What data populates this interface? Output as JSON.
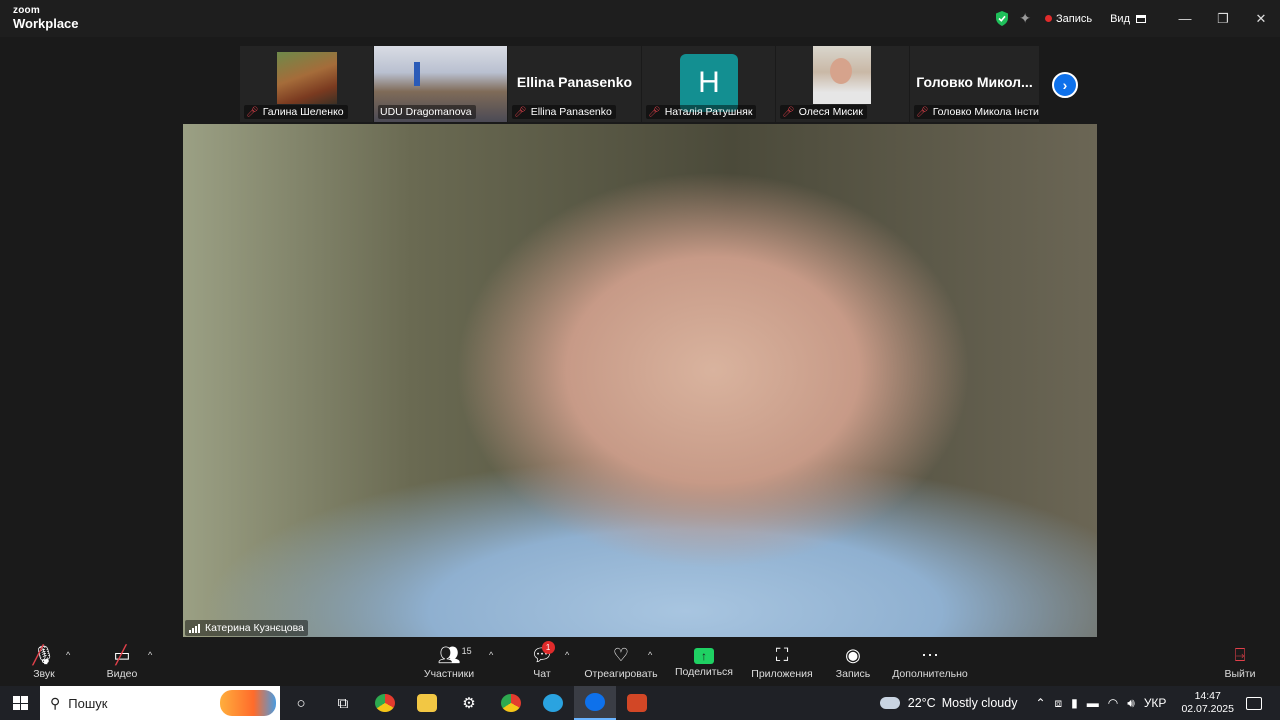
{
  "app": {
    "logo_top": "zoom",
    "logo_bottom": "Workplace"
  },
  "titlebar": {
    "record_label": "Запись",
    "view_label": "Вид",
    "minimize": "—",
    "maximize": "❐",
    "close": "✕"
  },
  "strip": {
    "tiles": [
      {
        "name": "Галина Шеленко",
        "big": ""
      },
      {
        "name": "UDU Dragomanova",
        "big": ""
      },
      {
        "name": "Ellina Panasenko",
        "big": "Ellina Panasenko"
      },
      {
        "name": "Наталія Ратушняк",
        "avatar_letter": "H"
      },
      {
        "name": "Олеся Мисик",
        "big": ""
      },
      {
        "name": "Головко Микола Інсти...",
        "big": "Головко Микол..."
      }
    ],
    "next_icon": "chevron-right-icon"
  },
  "speaker": {
    "name": "Катерина Кузнєцова"
  },
  "controls": {
    "audio": "Звук",
    "video": "Видео",
    "participants": "Участники",
    "participants_count": "15",
    "chat": "Чат",
    "chat_badge": "1",
    "react": "Отреагировать",
    "share": "Поделиться",
    "apps": "Приложения",
    "record": "Запись",
    "more": "Дополнительно",
    "leave": "Выйти"
  },
  "taskbar": {
    "search_placeholder": "Пошук",
    "weather_temp": "22°C",
    "weather_desc": "Mostly cloudy",
    "language": "УКР",
    "time": "14:47",
    "date": "02.07.2025"
  },
  "colors": {
    "accent": "#0e71eb",
    "muted": "#e0404a",
    "share": "#1fd163",
    "zoom_tile": "#138f91"
  }
}
